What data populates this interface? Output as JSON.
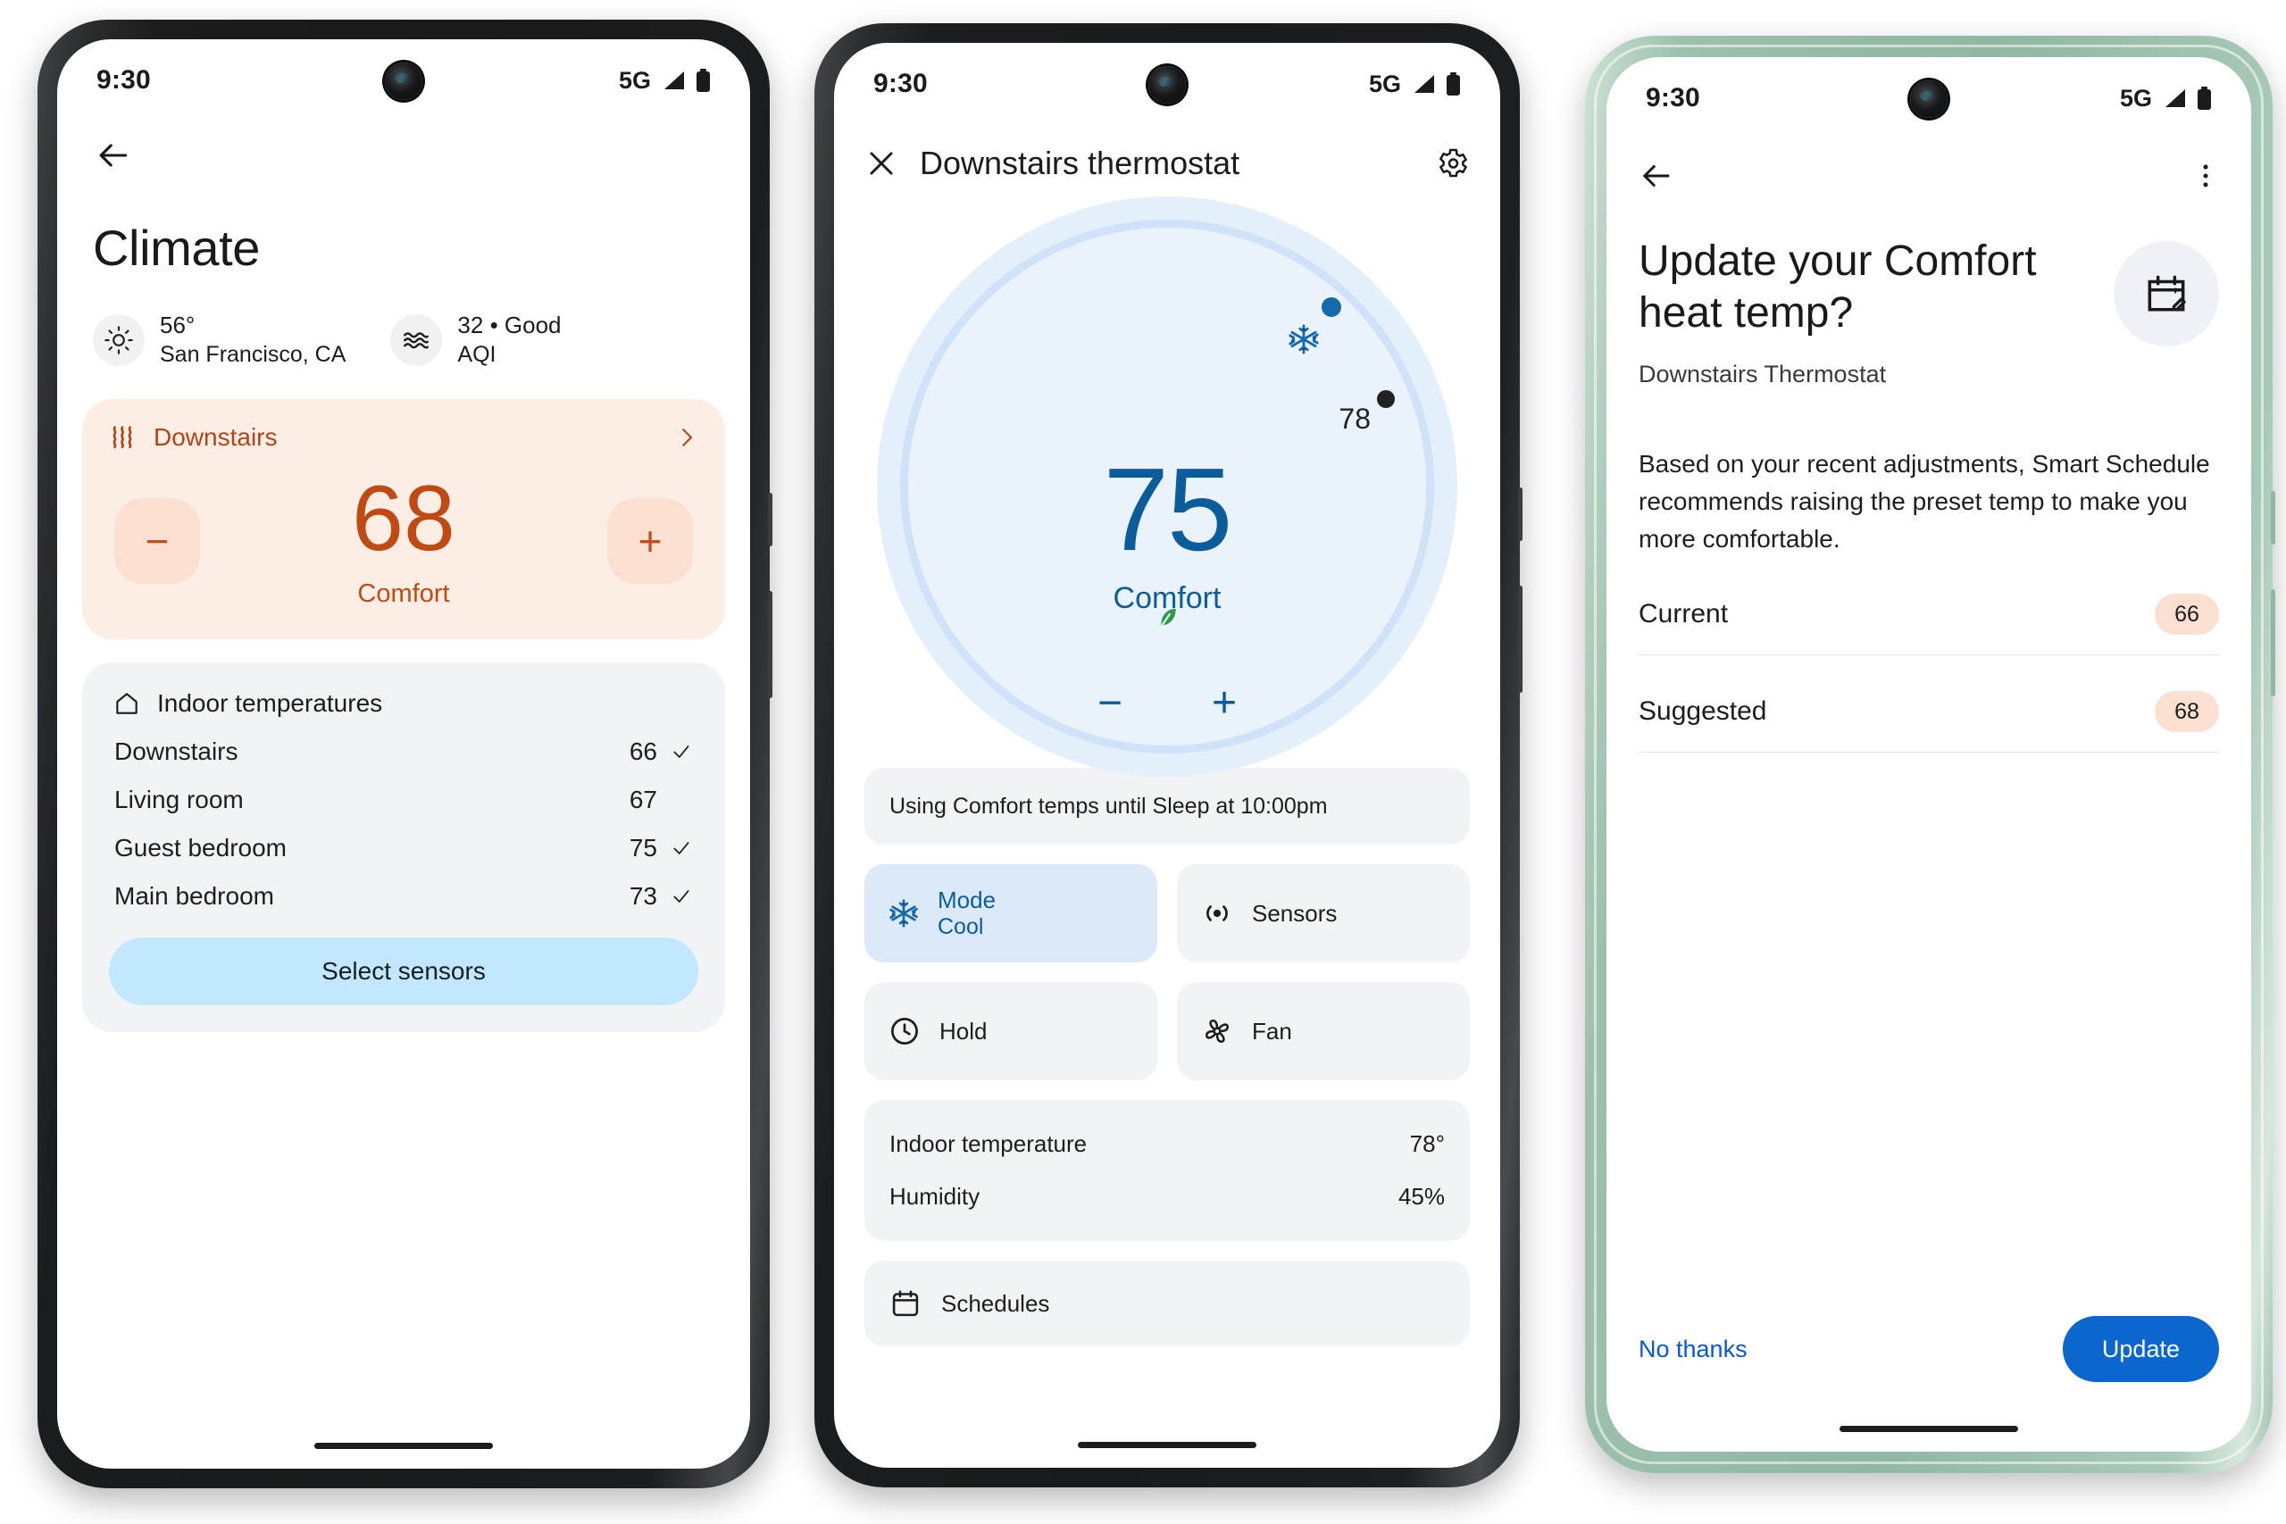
{
  "statusbar": {
    "time": "9:30",
    "network": "5G"
  },
  "phone1": {
    "back_label": "Back",
    "title": "Climate",
    "weather": {
      "temp": "56°",
      "location": "San Francisco, CA"
    },
    "aqi": {
      "value": "32 • Good",
      "label": "AQI"
    },
    "thermostat_card": {
      "name": "Downstairs",
      "decrease_label": "−",
      "increase_label": "+",
      "temperature": "68",
      "mode": "Comfort",
      "chevron": "›"
    },
    "sensors_card": {
      "title": "Indoor temperatures",
      "rows": [
        {
          "name": "Downstairs",
          "value": "66",
          "selected": true
        },
        {
          "name": "Living room",
          "value": "67",
          "selected": false
        },
        {
          "name": "Guest bedroom",
          "value": "75",
          "selected": true
        },
        {
          "name": "Main bedroom",
          "value": "73",
          "selected": true
        }
      ],
      "button_label": "Select sensors"
    }
  },
  "phone2": {
    "close_label": "Close",
    "title": "Downstairs thermostat",
    "settings_label": "Settings",
    "dial": {
      "temperature": "75",
      "mode": "Comfort",
      "current_temp_marker": "78",
      "decrease_label": "−",
      "increase_label": "+"
    },
    "banner": "Using Comfort temps until Sleep at 10:00pm",
    "tiles": [
      {
        "label": "Mode",
        "sub": "Cool",
        "icon": "snowflake-icon",
        "active": true
      },
      {
        "label": "Sensors",
        "sub": "",
        "icon": "sensors-icon",
        "active": false
      },
      {
        "label": "Hold",
        "sub": "",
        "icon": "clock-icon",
        "active": false
      },
      {
        "label": "Fan",
        "sub": "",
        "icon": "fan-icon",
        "active": false
      }
    ],
    "stats": [
      {
        "key": "Indoor temperature",
        "value": "78°"
      },
      {
        "key": "Humidity",
        "value": "45%"
      }
    ],
    "schedules_label": "Schedules"
  },
  "phone3": {
    "back_label": "Back",
    "overflow_label": "More options",
    "title": "Update your Comfort heat temp?",
    "subtitle": "Downstairs Thermostat",
    "icon": "calendar-edit-icon",
    "body": "Based on your recent adjustments, Smart Schedule recommends raising the preset temp to make you more comfortable.",
    "rows": [
      {
        "key": "Current",
        "value": "66"
      },
      {
        "key": "Suggested",
        "value": "68"
      }
    ],
    "dismiss_label": "No thanks",
    "confirm_label": "Update"
  },
  "colors": {
    "orange_card": "#fceee5",
    "orange_accent": "#bf4a14",
    "blue_dial": "#eaf3fc",
    "blue_accent": "#0b5c9a",
    "grey_card": "#f1f3f7",
    "primary_button": "#0b66d0",
    "pill": "#fbdfd0",
    "select_sensors": "#c2e7ff"
  }
}
